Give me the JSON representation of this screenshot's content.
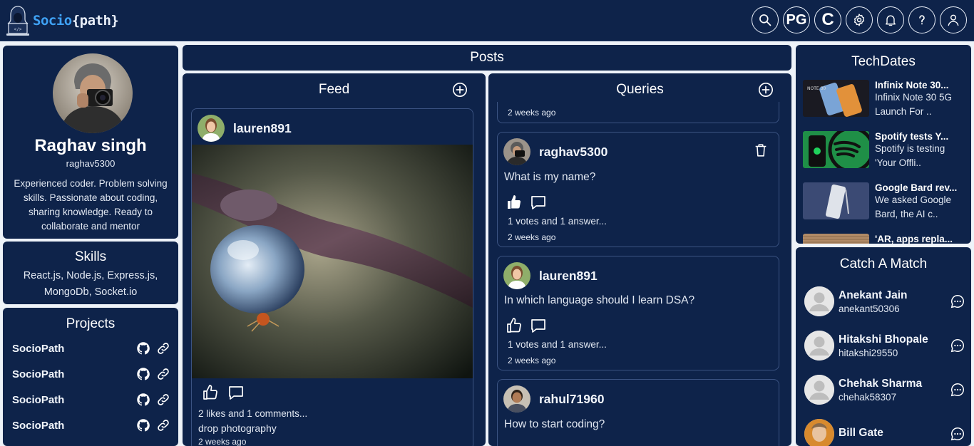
{
  "brand": {
    "part1": "Socio",
    "part2": "{path}"
  },
  "nav": {
    "initials1": "PG",
    "initials2": "C",
    "icons": [
      "search-icon",
      "gear-icon",
      "bell-icon",
      "help-icon",
      "user-icon"
    ]
  },
  "profile": {
    "name": "Raghav singh",
    "username": "raghav5300",
    "bio": "Experienced coder. Problem solving skills. Passionate about coding, sharing knowledge. Ready to collaborate and mentor"
  },
  "skills": {
    "title": "Skills",
    "text": "React.js, Node.js, Express.js, MongoDb, Socket.io"
  },
  "projects": {
    "title": "Projects",
    "items": [
      {
        "name": "SocioPath"
      },
      {
        "name": "SocioPath"
      },
      {
        "name": "SocioPath"
      },
      {
        "name": "SocioPath"
      }
    ]
  },
  "posts": {
    "title": "Posts"
  },
  "feed": {
    "title": "Feed",
    "post": {
      "username": "lauren891",
      "stats": "2 likes and 1 comments...",
      "caption": "drop photography",
      "time": "2 weeks ago"
    }
  },
  "queries": {
    "title": "Queries",
    "partial_time": "2 weeks ago",
    "items": [
      {
        "username": "raghav5300",
        "question": "What is my name?",
        "stats": "1 votes and 1 answer...",
        "time": "2 weeks ago"
      },
      {
        "username": "lauren891",
        "question": "In which language should I learn DSA?",
        "stats": "1 votes and 1 answer...",
        "time": "2 weeks ago"
      },
      {
        "username": "rahul71960",
        "question": "How to start coding?"
      }
    ]
  },
  "techdates": {
    "title": "TechDates",
    "items": [
      {
        "title": "Infinix Note 30...",
        "desc": "Infinix Note 30 5G Launch For .."
      },
      {
        "title": "Spotify tests Y...",
        "desc": "Spotify is testing 'Your Offli.."
      },
      {
        "title": "Google Bard rev...",
        "desc": "We asked Google Bard, the AI c.."
      },
      {
        "title": "'AR, apps repla..."
      }
    ]
  },
  "match": {
    "title": "Catch A Match",
    "items": [
      {
        "name": "Anekant Jain",
        "username": "anekant50306"
      },
      {
        "name": "Hitakshi Bhopale",
        "username": "hitakshi29550"
      },
      {
        "name": "Chehak Sharma",
        "username": "chehak58307"
      },
      {
        "name": "Bill Gate",
        "username": ""
      }
    ]
  },
  "colors": {
    "background": "#eef3f9",
    "panel": "#0e234a",
    "border": "#3b5382",
    "accent": "#3fa2f5"
  }
}
